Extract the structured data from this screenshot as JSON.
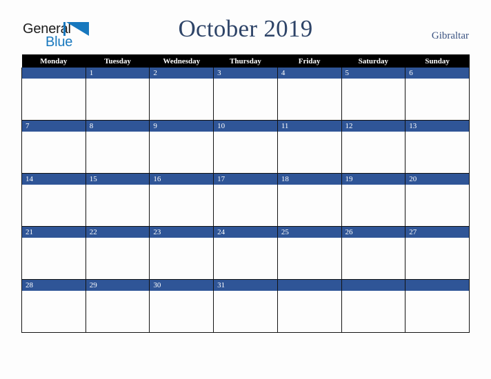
{
  "brand": {
    "name_part1": "General",
    "name_part2": "Blue",
    "mark_icon": "triangle-flag-icon",
    "color_dark": "#1b1b1b",
    "color_blue": "#1878be"
  },
  "header": {
    "title": "October 2019",
    "country": "Gibraltar",
    "title_color": "#2e4468",
    "country_color": "#3b5382"
  },
  "calendar": {
    "header_bg": "#000000",
    "header_text_color": "#ffffff",
    "date_bar_color": "#2f5597",
    "date_text_color": "#ffffff",
    "cell_bg": "#fdfdfd",
    "border_color": "#111111",
    "weekdays": [
      "Monday",
      "Tuesday",
      "Wednesday",
      "Thursday",
      "Friday",
      "Saturday",
      "Sunday"
    ],
    "weeks": [
      [
        "",
        "1",
        "2",
        "3",
        "4",
        "5",
        "6"
      ],
      [
        "7",
        "8",
        "9",
        "10",
        "11",
        "12",
        "13"
      ],
      [
        "14",
        "15",
        "16",
        "17",
        "18",
        "19",
        "20"
      ],
      [
        "21",
        "22",
        "23",
        "24",
        "25",
        "26",
        "27"
      ],
      [
        "28",
        "29",
        "30",
        "31",
        "",
        "",
        ""
      ]
    ]
  }
}
